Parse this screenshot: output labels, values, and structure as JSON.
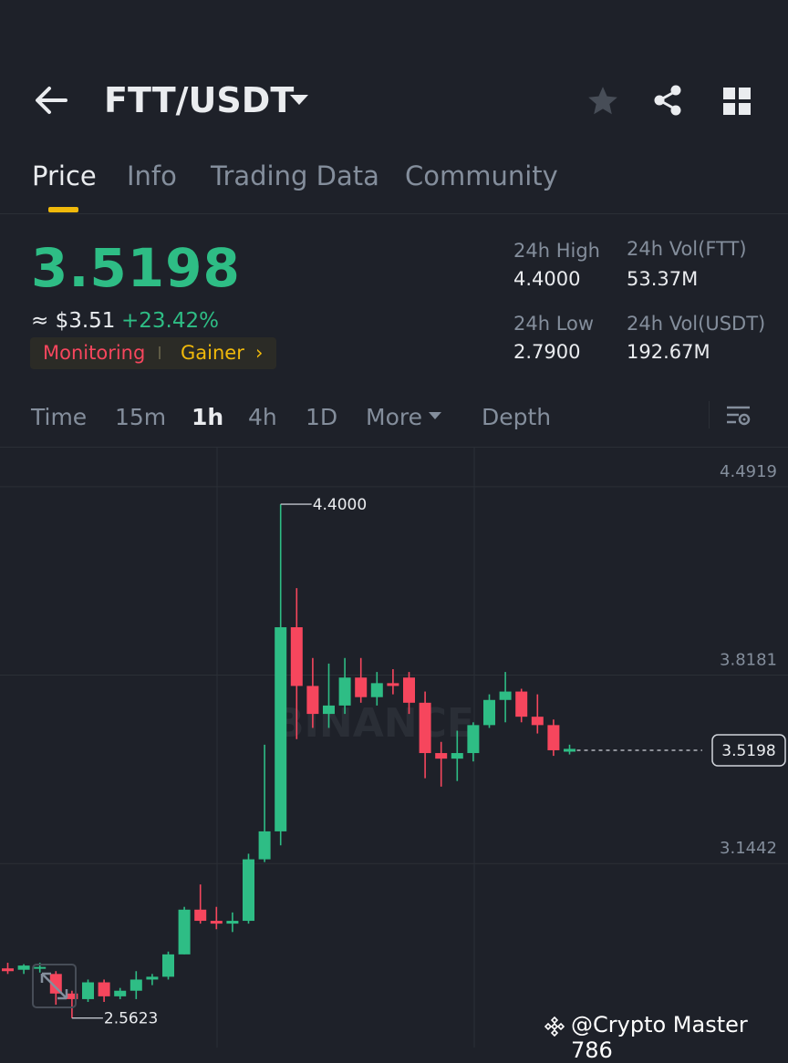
{
  "header": {
    "pair": "FTT/USDT",
    "icons": [
      "back-arrow-icon",
      "chevron-down-icon",
      "star-icon",
      "share-icon",
      "grid-icon"
    ]
  },
  "tabs": [
    {
      "label": "Price",
      "active": true
    },
    {
      "label": "Info",
      "active": false
    },
    {
      "label": "Trading Data",
      "active": false
    },
    {
      "label": "Community",
      "active": false
    }
  ],
  "price": {
    "last": "3.5198",
    "usd": "≈ $3.51",
    "change": "+23.42%",
    "tag_monitoring": "Monitoring",
    "tag_gainer": "Gainer",
    "tag_chevron": "›"
  },
  "stats": {
    "high_label": "24h High",
    "high_value": "4.4000",
    "low_label": "24h Low",
    "low_value": "2.7900",
    "vol_ftt_label": "24h Vol(FTT)",
    "vol_ftt_value": "53.37M",
    "vol_usdt_label": "24h Vol(USDT)",
    "vol_usdt_value": "192.67M"
  },
  "intervals": {
    "items": [
      "Time",
      "15m",
      "1h",
      "4h",
      "1D",
      "More",
      "Depth"
    ],
    "active": "1h"
  },
  "colors": {
    "up": "#2ebd85",
    "down": "#f6465d",
    "accent": "#f0b90b",
    "background": "#1e2129"
  },
  "chart_data": {
    "type": "candlestick",
    "y_axis_labels": [
      "4.4919",
      "3.8181",
      "3.1442"
    ],
    "y_axis_values": [
      4.4919,
      3.8181,
      3.1442
    ],
    "ylim": [
      2.47,
      4.56
    ],
    "current_price_label": "3.5198",
    "current_price": 3.5198,
    "high_annotation": "4.4000",
    "low_annotation": "2.5623",
    "watermark": "BINANCE",
    "candles": [
      {
        "o": 2.74,
        "h": 2.76,
        "l": 2.72,
        "c": 2.73
      },
      {
        "o": 2.735,
        "h": 2.755,
        "l": 2.72,
        "c": 2.75
      },
      {
        "o": 2.74,
        "h": 2.76,
        "l": 2.725,
        "c": 2.745
      },
      {
        "o": 2.72,
        "h": 2.73,
        "l": 2.61,
        "c": 2.65
      },
      {
        "o": 2.65,
        "h": 2.66,
        "l": 2.562,
        "c": 2.63
      },
      {
        "o": 2.63,
        "h": 2.7,
        "l": 2.62,
        "c": 2.69
      },
      {
        "o": 2.69,
        "h": 2.7,
        "l": 2.62,
        "c": 2.64
      },
      {
        "o": 2.64,
        "h": 2.67,
        "l": 2.63,
        "c": 2.66
      },
      {
        "o": 2.66,
        "h": 2.73,
        "l": 2.63,
        "c": 2.7
      },
      {
        "o": 2.7,
        "h": 2.72,
        "l": 2.68,
        "c": 2.71
      },
      {
        "o": 2.71,
        "h": 2.8,
        "l": 2.7,
        "c": 2.79
      },
      {
        "o": 2.79,
        "h": 2.96,
        "l": 2.79,
        "c": 2.95
      },
      {
        "o": 2.95,
        "h": 3.04,
        "l": 2.9,
        "c": 2.91
      },
      {
        "o": 2.91,
        "h": 2.96,
        "l": 2.88,
        "c": 2.9
      },
      {
        "o": 2.9,
        "h": 2.94,
        "l": 2.87,
        "c": 2.91
      },
      {
        "o": 2.91,
        "h": 3.15,
        "l": 2.9,
        "c": 3.13
      },
      {
        "o": 3.13,
        "h": 3.54,
        "l": 3.12,
        "c": 3.23
      },
      {
        "o": 3.23,
        "h": 4.4,
        "l": 3.18,
        "c": 3.96
      },
      {
        "o": 3.96,
        "h": 4.1,
        "l": 3.56,
        "c": 3.75
      },
      {
        "o": 3.75,
        "h": 3.85,
        "l": 3.6,
        "c": 3.65
      },
      {
        "o": 3.65,
        "h": 3.83,
        "l": 3.6,
        "c": 3.68
      },
      {
        "o": 3.68,
        "h": 3.85,
        "l": 3.65,
        "c": 3.78
      },
      {
        "o": 3.78,
        "h": 3.85,
        "l": 3.69,
        "c": 3.71
      },
      {
        "o": 3.71,
        "h": 3.8,
        "l": 3.68,
        "c": 3.76
      },
      {
        "o": 3.76,
        "h": 3.81,
        "l": 3.72,
        "c": 3.75
      },
      {
        "o": 3.78,
        "h": 3.8,
        "l": 3.65,
        "c": 3.69
      },
      {
        "o": 3.69,
        "h": 3.73,
        "l": 3.42,
        "c": 3.51
      },
      {
        "o": 3.51,
        "h": 3.55,
        "l": 3.39,
        "c": 3.49
      },
      {
        "o": 3.49,
        "h": 3.59,
        "l": 3.41,
        "c": 3.51
      },
      {
        "o": 3.51,
        "h": 3.62,
        "l": 3.48,
        "c": 3.61
      },
      {
        "o": 3.61,
        "h": 3.72,
        "l": 3.6,
        "c": 3.7
      },
      {
        "o": 3.7,
        "h": 3.8,
        "l": 3.62,
        "c": 3.73
      },
      {
        "o": 3.73,
        "h": 3.74,
        "l": 3.62,
        "c": 3.64
      },
      {
        "o": 3.64,
        "h": 3.72,
        "l": 3.58,
        "c": 3.61
      },
      {
        "o": 3.61,
        "h": 3.63,
        "l": 3.5,
        "c": 3.52
      },
      {
        "o": 3.515,
        "h": 3.54,
        "l": 3.505,
        "c": 3.525
      }
    ]
  },
  "watermark_text": "@Crypto Master 786"
}
